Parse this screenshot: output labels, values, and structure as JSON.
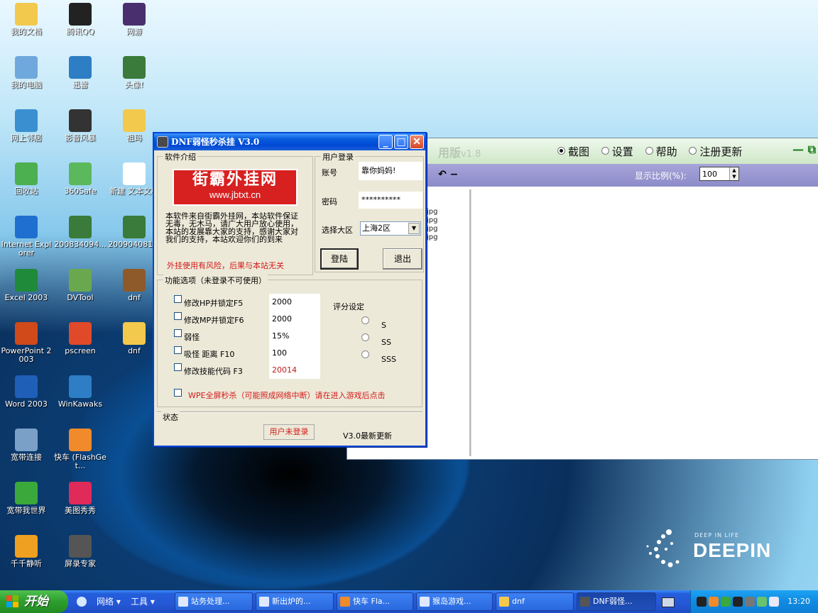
{
  "desktop": {
    "icons": [
      {
        "label": "我的文档",
        "color": "#f2c94c"
      },
      {
        "label": "腾讯QQ",
        "color": "#222222"
      },
      {
        "label": "网游",
        "color": "#4a2f6e"
      },
      {
        "label": "我的电脑",
        "color": "#6fa8dc"
      },
      {
        "label": "迅雷",
        "color": "#2d7ec4"
      },
      {
        "label": "头像!",
        "color": "#3a7a3a"
      },
      {
        "label": "网上邻居",
        "color": "#3a8fd0"
      },
      {
        "label": "影音风暴",
        "color": "#333333"
      },
      {
        "label": "祖玛",
        "color": "#f2c94c"
      },
      {
        "label": "回收站",
        "color": "#4caf50"
      },
      {
        "label": "360Safe",
        "color": "#5cb85c"
      },
      {
        "label": "新建 文本文档",
        "color": "#ffffff"
      },
      {
        "label": "Internet Explorer",
        "color": "#1f6fd0"
      },
      {
        "label": "200834094...",
        "color": "#3a7a3a"
      },
      {
        "label": "200904081...",
        "color": "#3a7a3a"
      },
      {
        "label": "Excel 2003",
        "color": "#1e8a3a"
      },
      {
        "label": "DVTool",
        "color": "#6aa84f"
      },
      {
        "label": "dnf",
        "color": "#8e5a2a"
      },
      {
        "label": "PowerPoint 2003",
        "color": "#d04a1a"
      },
      {
        "label": "pscreen",
        "color": "#e04a2a"
      },
      {
        "label": "dnf",
        "color": "#f2c94c"
      },
      {
        "label": "Word 2003",
        "color": "#1f5fb8"
      },
      {
        "label": "WinKawaks",
        "color": "#2d7ec4"
      },
      {
        "label": "宽带连接",
        "color": "#7aa0c8"
      },
      {
        "label": "快车 (FlashGet...",
        "color": "#f08a2a"
      },
      {
        "label": "宽带我世界",
        "color": "#3aa83a"
      },
      {
        "label": "美图秀秀",
        "color": "#e02a5a"
      },
      {
        "label": "千千静听",
        "color": "#f0a020"
      },
      {
        "label": "屏录专家",
        "color": "#555555"
      }
    ],
    "brand_small": "DEEP IN LIFE",
    "brand_big": "DEEPIN"
  },
  "bg_window": {
    "version_text": "用版",
    "version_num": "v1.8",
    "tabs": [
      {
        "label": "截图",
        "checked": true
      },
      {
        "label": "设置",
        "checked": false
      },
      {
        "label": "帮助",
        "checked": false
      },
      {
        "label": "注册更新",
        "checked": false
      }
    ],
    "minmax": "— ⧉",
    "tools": "↶  −",
    "scale_label": "显示比例(%):",
    "scale_value": "100",
    "files": [
      "jpg",
      "jpg",
      "jpg",
      "jpg"
    ]
  },
  "dialog": {
    "title": "DNF弱怪秒杀挂 V3.0",
    "intro_group": "软件介绍",
    "logo_line1": "街霸外挂网",
    "logo_line2": "www.jbtxt.cn",
    "intro_text": "本软件来自街霸外挂网，本站软件保证无毒，无木马，请广大用户放心使用，本站的发展靠大家的支持，感谢大家对我们的支持，本站欢迎你们的到来",
    "warning": "外挂使用有风险，后果与本站无关",
    "login_group": "用户登录",
    "account_label": "账号",
    "account_value": "靠你妈妈!",
    "password_label": "密码",
    "password_value": "**********",
    "region_label": "选择大区",
    "region_value": "上海2区",
    "login_button": "登陆",
    "exit_button": "退出",
    "func_group": "功能选项（未登录不可使用）",
    "options": [
      {
        "label": "修改HP并锁定F5",
        "value": "2000"
      },
      {
        "label": "修改MP并锁定F6",
        "value": "2000"
      },
      {
        "label": "弱怪",
        "value": "15%"
      },
      {
        "label": "吸怪 距离 F10",
        "value": "100"
      },
      {
        "label": "修改技能代码 F3",
        "value": "20014"
      }
    ],
    "rating_label": "评分设定",
    "ratings": [
      "S",
      "SS",
      "SSS"
    ],
    "wpe_text": "WPE全屏秒杀（可能照成网络中断）请在进入游戏后点击",
    "status_group": "状态",
    "status_text": "用户未登录",
    "update_text": "V3.0最新更新"
  },
  "taskbar": {
    "start": "开始",
    "quick": [
      "网络 ▾",
      "工具 ▾"
    ],
    "buttons": [
      {
        "label": "站务处理..."
      },
      {
        "label": "新出炉的..."
      },
      {
        "label": "快车 Fla..."
      },
      {
        "label": "猴岛游戏..."
      },
      {
        "label": "dnf"
      },
      {
        "label": "DNF弱怪..."
      }
    ],
    "clock": "13:20"
  }
}
